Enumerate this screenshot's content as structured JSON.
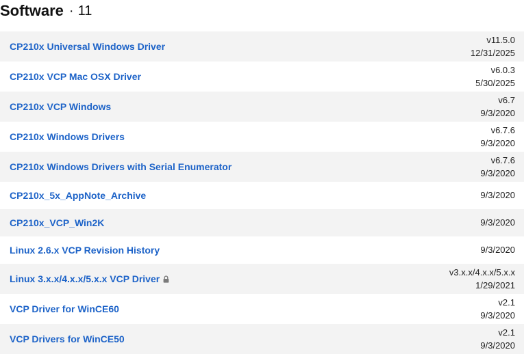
{
  "section": {
    "title": "Software",
    "separator": "·",
    "count": "11"
  },
  "items": [
    {
      "name": "CP210x Universal Windows Driver",
      "version": "v11.5.0",
      "date": "12/31/2025"
    },
    {
      "name": "CP210x VCP Mac OSX Driver",
      "version": "v6.0.3",
      "date": "5/30/2025"
    },
    {
      "name": "CP210x VCP Windows",
      "version": "v6.7",
      "date": "9/3/2020"
    },
    {
      "name": "CP210x Windows Drivers",
      "version": "v6.7.6",
      "date": "9/3/2020"
    },
    {
      "name": "CP210x Windows Drivers with Serial Enumerator",
      "version": "v6.7.6",
      "date": "9/3/2020"
    },
    {
      "name": "CP210x_5x_AppNote_Archive",
      "version": "",
      "date": "9/3/2020"
    },
    {
      "name": "CP210x_VCP_Win2K",
      "version": "",
      "date": "9/3/2020"
    },
    {
      "name": "Linux 2.6.x VCP Revision History",
      "version": "",
      "date": "9/3/2020"
    },
    {
      "name": "Linux 3.x.x/4.x.x/5.x.x VCP Driver",
      "version": "v3.x.x/4.x.x/5.x.x",
      "date": "1/29/2021",
      "icon": "lock-icon"
    },
    {
      "name": "VCP Driver for WinCE60",
      "version": "v2.1",
      "date": "9/3/2020"
    },
    {
      "name": "VCP Drivers for WinCE50",
      "version": "v2.1",
      "date": "9/3/2020"
    }
  ]
}
